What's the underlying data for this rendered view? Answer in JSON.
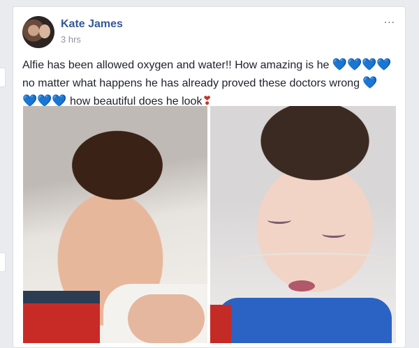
{
  "post": {
    "author": "Kate James",
    "time": "3 hrs",
    "menu_icon": "...",
    "text_line1": "Alfie has been allowed oxygen and water!! How amazing is he",
    "text_line2": "no matter what happens he has already proved these doctors wrong",
    "text_line3": "how beautiful does he look",
    "hearts_blue": "💙",
    "heart_red": "❣"
  },
  "colors": {
    "author": "#365899",
    "meta": "#90949c",
    "text": "#1d2129",
    "blue_heart": "#3b8ee8",
    "red_heart": "#c8322b"
  }
}
